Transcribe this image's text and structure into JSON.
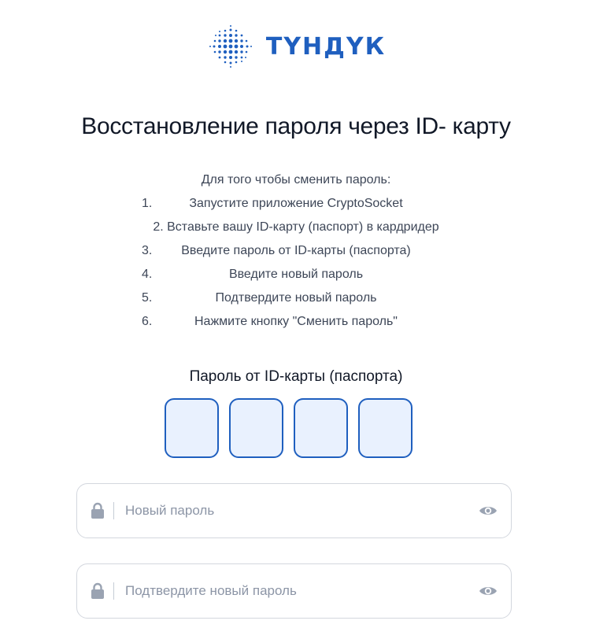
{
  "brand": {
    "logo_text": "ТҮНДҮК",
    "accent_color": "#1f5fbf"
  },
  "page_title": "Восстановление пароля через ID- карту",
  "instructions": {
    "intro": "Для того чтобы сменить пароль:",
    "steps": [
      {
        "num": "1.",
        "text": "Запустите приложение CryptoSocket"
      },
      {
        "num": "",
        "text": "2. Вставьте вашу ID-карту (паспорт) в кардридер"
      },
      {
        "num": "3.",
        "text": "Введите пароль от ID-карты (паспорта)"
      },
      {
        "num": "4.",
        "text": "Введите новый пароль"
      },
      {
        "num": "5.",
        "text": "Подтвердите новый пароль"
      },
      {
        "num": "6.",
        "text": "Нажмите кнопку \"Сменить пароль\""
      }
    ]
  },
  "pin": {
    "label": "Пароль от ID-карты (паспорта)",
    "box_count": 4
  },
  "new_password": {
    "placeholder": "Новый пароль",
    "lock_icon": "lock-icon",
    "toggle_icon": "eye-icon"
  },
  "confirm_password": {
    "placeholder": "Подтвердите новый пароль",
    "lock_icon": "lock-icon",
    "toggle_icon": "eye-icon"
  }
}
